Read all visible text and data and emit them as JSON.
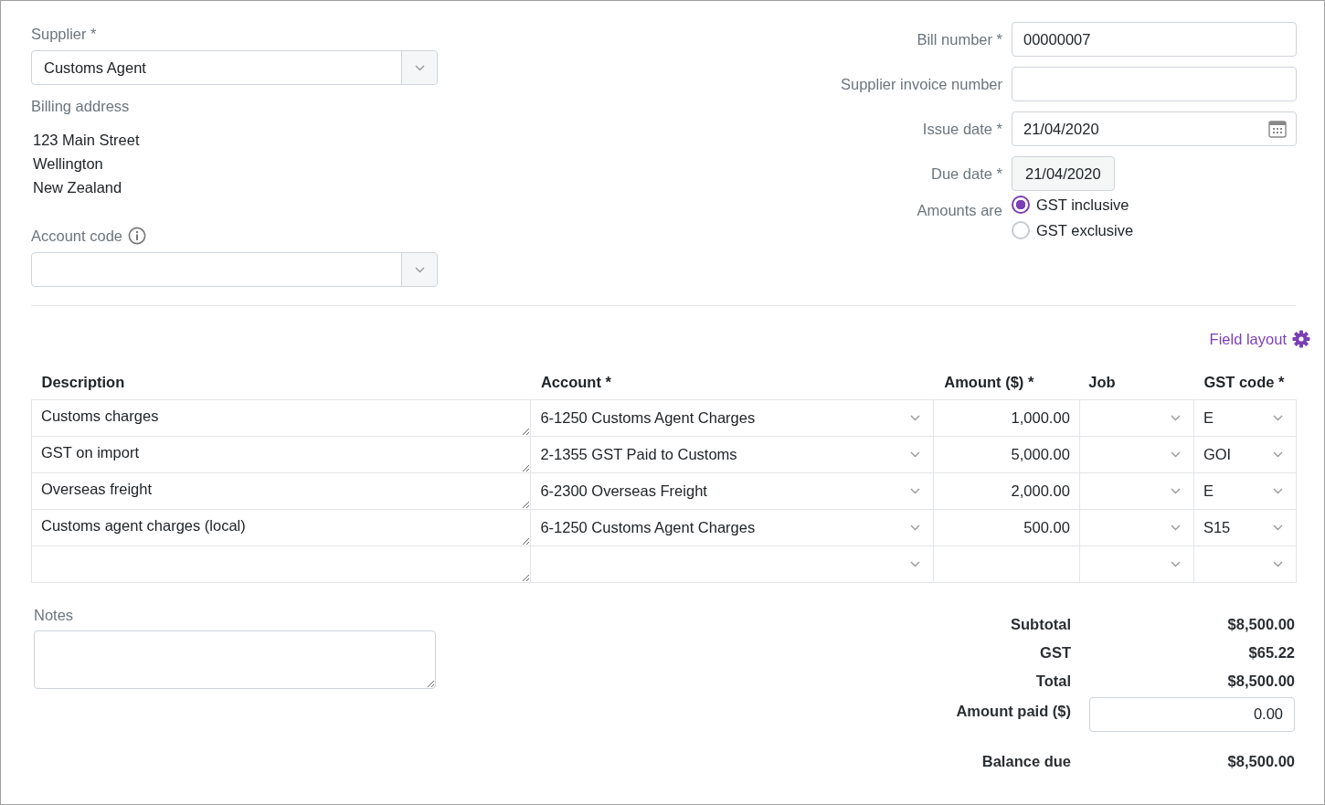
{
  "supplier": {
    "label": "Supplier *",
    "value": "Customs Agent"
  },
  "billing_address": {
    "label": "Billing address",
    "lines": [
      "123 Main Street",
      "Wellington",
      "New Zealand"
    ]
  },
  "account_code": {
    "label": "Account code"
  },
  "fields": [
    {
      "kind": "text",
      "label": "Bill number *",
      "value": "00000007"
    },
    {
      "kind": "text",
      "label": "Supplier invoice number"
    },
    {
      "kind": "date",
      "label": "Issue date *",
      "value": "21/04/2020"
    },
    {
      "kind": "button",
      "label": "Due date *",
      "value": "21/04/2020"
    }
  ],
  "amounts_are": {
    "label": "Amounts are",
    "options": [
      {
        "label": "GST inclusive",
        "selected": true
      },
      {
        "label": "GST exclusive",
        "selected": false
      }
    ]
  },
  "field_layout_link": "Field layout",
  "table": {
    "columns": [
      "Description",
      "Account *",
      "Amount ($) *",
      "Job",
      "GST code *"
    ],
    "rows": [
      {
        "description": "Customs charges",
        "account": "6-1250 Customs Agent Charges",
        "amount": "1,000.00",
        "gst_code": "E"
      },
      {
        "description": "GST on import",
        "account": "2-1355 GST Paid to Customs",
        "amount": "5,000.00",
        "gst_code": "GOI"
      },
      {
        "description": "Overseas freight",
        "account": "6-2300 Overseas Freight",
        "amount": "2,000.00",
        "gst_code": "E"
      },
      {
        "description": "Customs agent charges (local)",
        "account": "6-1250 Customs Agent Charges",
        "amount": "500.00",
        "gst_code": "S15"
      },
      {}
    ]
  },
  "notes": {
    "label": "Notes"
  },
  "totals": [
    {
      "label": "Subtotal",
      "value": "$8,500.00"
    },
    {
      "label": "GST",
      "value": "$65.22"
    },
    {
      "label": "Total",
      "value": "$8,500.00"
    }
  ],
  "amount_paid": {
    "label": "Amount paid ($)",
    "value": "0.00"
  },
  "balance_due": {
    "label": "Balance due",
    "value": "$8,500.00"
  }
}
